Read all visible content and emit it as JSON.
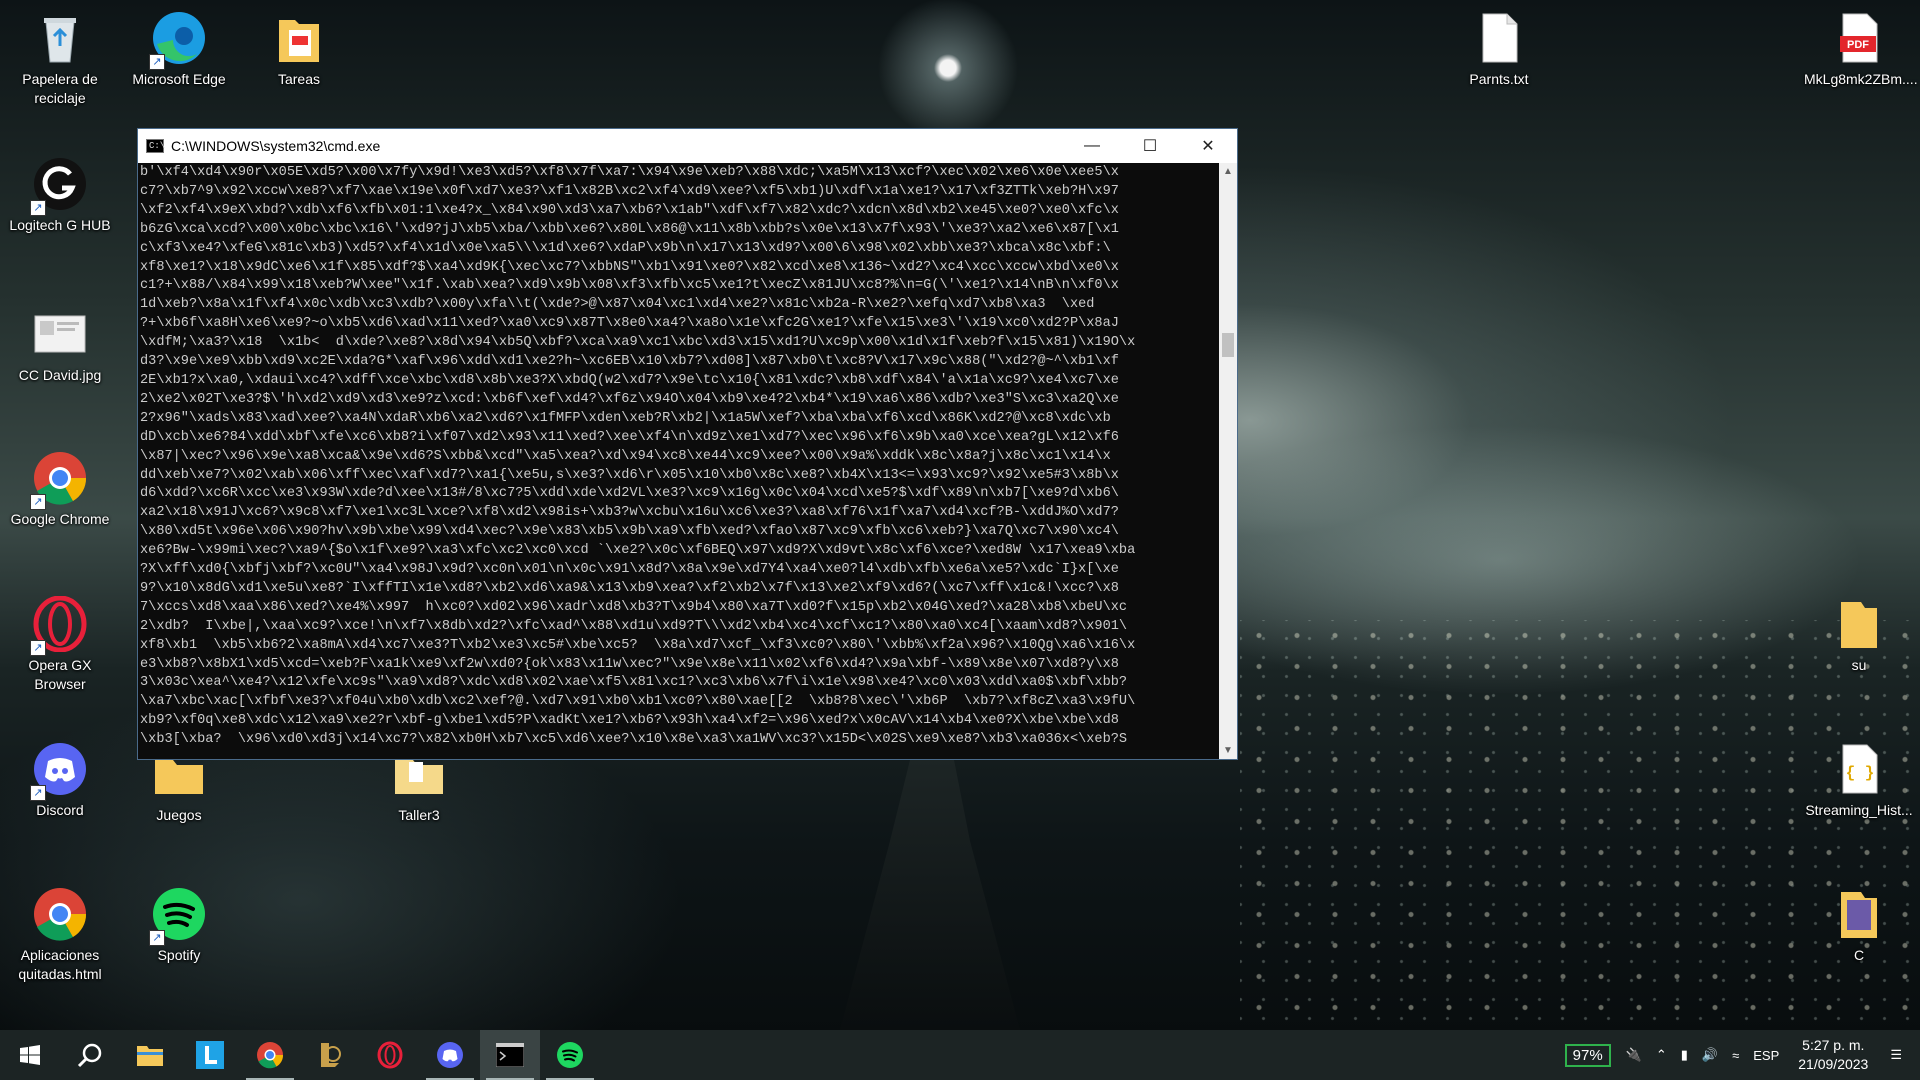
{
  "desktop": {
    "icons": [
      {
        "label": "Papelera de reciclaje",
        "icon": "recycle-bin-icon"
      },
      {
        "label": "Microsoft Edge",
        "icon": "edge-icon"
      },
      {
        "label": "Tareas",
        "icon": "pdf-folder-icon"
      },
      {
        "label": "Logitech G HUB",
        "icon": "logitech-icon"
      },
      {
        "label": "CC David.jpg",
        "icon": "image-file-icon"
      },
      {
        "label": "Google Chrome",
        "icon": "chrome-icon"
      },
      {
        "label": "Opera GX Browser",
        "icon": "opera-icon"
      },
      {
        "label": "Discord",
        "icon": "discord-icon"
      },
      {
        "label": "Juegos",
        "icon": "folder-icon"
      },
      {
        "label": "Taller3",
        "icon": "folder-icon"
      },
      {
        "label": "Aplicaciones quitadas.html",
        "icon": "chrome-icon"
      },
      {
        "label": "Spotify",
        "icon": "spotify-icon"
      },
      {
        "label": "Parnts.txt",
        "icon": "text-file-icon"
      },
      {
        "label": "MkLg8mk2ZBm....",
        "icon": "pdf-icon"
      },
      {
        "label": "su",
        "icon": "folder-icon"
      },
      {
        "label": "Streaming_Hist...",
        "icon": "json-file-icon"
      },
      {
        "label": "C",
        "icon": "folder-icon"
      }
    ]
  },
  "cmd_window": {
    "title": "C:\\WINDOWS\\system32\\cmd.exe",
    "lines": [
      "b'\\xf4\\xd4\\x90r\\x05E\\xd5?\\x00\\x7fy\\x9d!\\xe3\\xd5?\\xf8\\x7f\\xa7:\\x94\\x9e\\xeb?\\x88\\xdc;\\xa5M\\x13\\xcf?\\xec\\x02\\xe6\\x0e\\xee5\\x",
      "c7?\\xb7^9\\x92\\xccw\\xe8?\\xf7\\xae\\x19e\\x0f\\xd7\\xe3?\\xf1\\x82B\\xc2\\xf4\\xd9\\xee?\\xf5\\xb1)U\\xdf\\x1a\\xe1?\\x17\\xf3ZTTk\\xeb?H\\x97",
      "\\xf2\\xf4\\x9eX\\xbd?\\xdb\\xf6\\xfb\\x01:1\\xe4?x_\\x84\\x90\\xd3\\xa7\\xb6?\\x1ab\"\\xdf\\xf7\\x82\\xdc?\\xdcn\\x8d\\xb2\\xe45\\xe0?\\xe0\\xfc\\x",
      "b6zG\\xca\\xcd?\\x00\\x0bc\\xbc\\x16\\'\\xd9?jJ\\xb5\\xba/\\xbb\\xe6?\\x80L\\x86@\\x11\\x8b\\xbb?s\\x0e\\x13\\x7f\\x93\\'\\xe3?\\xa2\\xe6\\x87[\\x1",
      "c\\xf3\\xe4?\\xfeG\\x81c\\xb3)\\xd5?\\xf4\\x1d\\x0e\\xa5\\\\\\x1d\\xe6?\\xdaP\\x9b\\n\\x17\\x13\\xd9?\\x00\\6\\x98\\x02\\xbb\\xe3?\\xbca\\x8c\\xbf:\\",
      "xf8\\xe1?\\x18\\x9dC\\xe6\\x1f\\x85\\xdf?$\\xa4\\xd9K{\\xec\\xc7?\\xbbNS\"\\xb1\\x91\\xe0?\\x82\\xcd\\xe8\\x136~\\xd2?\\xc4\\xcc\\xccw\\xbd\\xe0\\x",
      "c1?+\\x88/\\x84\\x99\\x18\\xeb?W\\xee\"\\x1f.\\xab\\xea?\\xd9\\x9b\\x08\\xf3\\xfb\\xc5\\xe1?t\\xecZ\\x81JU\\xc8?%\\n=G(\\'\\xe1?\\x14\\nB\\n\\xf0\\x",
      "1d\\xeb?\\x8a\\x1f\\xf4\\x0c\\xdb\\xc3\\xdb?\\x00y\\xfa\\\\t(\\xde?>@\\x87\\x04\\xc1\\xd4\\xe2?\\x81c\\xb2a-R\\xe2?\\xefq\\xd7\\xb8\\xa3  \\xed",
      "?+\\xb6f\\xa8H\\xe6\\xe9?~o\\xb5\\xd6\\xad\\x11\\xed?\\xa0\\xc9\\x87T\\x8e0\\xa4?\\xa8o\\x1e\\xfc2G\\xe1?\\xfe\\x15\\xe3\\'\\x19\\xc0\\xd2?P\\x8aJ",
      "\\xdfM;\\xa3?\\x18  \\x1b<  d\\xde?\\xe8?\\x8d\\x94\\xb5Q\\xbf?\\xca\\xa9\\xc1\\xbc\\xd3\\x15\\xd1?U\\xc9p\\x00\\x1d\\x1f\\xeb?f\\x15\\x81)\\x19O\\x",
      "d3?\\x9e\\xe9\\xbb\\xd9\\xc2E\\xda?G*\\xaf\\x96\\xdd\\xd1\\xe2?h~\\xc6EB\\x10\\xb7?\\xd08]\\x87\\xb0\\t\\xc8?V\\x17\\x9c\\x88(\"\\xd2?@~^\\xb1\\xf",
      "2E\\xb1?x\\xa0,\\xdaui\\xc4?\\xdff\\xce\\xbc\\xd8\\x8b\\xe3?X\\xbdQ(w2\\xd7?\\x9e\\tc\\x10{\\x81\\xdc?\\xb8\\xdf\\x84\\'a\\x1a\\xc9?\\xe4\\xc7\\xe",
      "2\\xe2\\x02T\\xe3?$\\'h\\xd2\\xd9\\xd3\\xe9?z\\xcd:\\xb6f\\xef\\xd4?\\xf6z\\x94O\\x04\\xb9\\xe4?2\\xb4*\\x19\\xa6\\x86\\xdb?\\xe3\"S\\xc3\\xa2Q\\xe",
      "2?x96\"\\xads\\x83\\xad\\xee?\\xa4N\\xdaR\\xb6\\xa2\\xd6?\\x1fMFP\\xden\\xeb?R\\xb2|\\x1a5W\\xef?\\xba\\xba\\xf6\\xcd\\x86K\\xd2?@\\xc8\\xdc\\xb",
      "dD\\xcb\\xe6?84\\xdd\\xbf\\xfe\\xc6\\xb8?i\\xf07\\xd2\\x93\\x11\\xed?\\xee\\xf4\\n\\xd9z\\xe1\\xd7?\\xec\\x96\\xf6\\x9b\\xa0\\xce\\xea?gL\\x12\\xf6",
      "\\x87|\\xec?\\x96\\x9e\\xa8\\xca&\\x9e\\xd6?S\\xbb&\\xcd\"\\xa5\\xea?\\xd\\x94\\xc8\\xe44\\xc9\\xee?\\x00\\x9a%\\xddk\\x8c\\x8a?j\\x8c\\xc1\\x14\\x",
      "dd\\xeb\\xe7?\\x02\\xab\\x06\\xff\\xec\\xaf\\xd7?\\xa1{\\xe5u,s\\xe3?\\xd6\\r\\x05\\x10\\xb0\\x8c\\xe8?\\xb4X\\x13<=\\x93\\xc9?\\x92\\xe5#3\\x8b\\x",
      "d6\\xdd?\\xc6R\\xcc\\xe3\\x93W\\xde?d\\xee\\x13#/8\\xc7?5\\xdd\\xde\\xd2VL\\xe3?\\xc9\\x16g\\x0c\\x04\\xcd\\xe5?$\\xdf\\x89\\n\\xb7[\\xe9?d\\xb6\\",
      "xa2\\x18\\x91J\\xc6?\\x9c8\\xf7\\xe1\\xc3L\\xce?\\xf8\\xd2\\x98is+\\xb3?w\\xcbu\\x16u\\xc6\\xe3?\\xa8\\xf76\\x1f\\xa7\\xd4\\xcf?B-\\xddJ%O\\xd7?",
      "\\x80\\xd5t\\x96e\\x06\\x90?hv\\x9b\\xbe\\x99\\xd4\\xec?\\x9e\\x83\\xb5\\x9b\\xa9\\xfb\\xed?\\xfao\\x87\\xc9\\xfb\\xc6\\xeb?}\\xa7Q\\xc7\\x90\\xc4\\",
      "xe6?Bw-\\x99mi\\xec?\\xa9^{$o\\x1f\\xe9?\\xa3\\xfc\\xc2\\xc0\\xcd `\\xe2?\\x0c\\xf6BEQ\\x97\\xd9?X\\xd9vt\\x8c\\xf6\\xce?\\xed8W \\x17\\xea9\\xba",
      "?X\\xff\\xd0{\\xbfj\\xbf?\\xc0U\"\\xa4\\x98J\\x9d?\\xc0n\\x01\\n\\x0c\\x91\\x8d?\\x8a\\x9e\\xd7Y4\\xa4\\xe0?l4\\xdb\\xfb\\xe6a\\xe5?\\xdc`I}x[\\xe",
      "9?\\x10\\x8dG\\xd1\\xe5u\\xe8?`I\\xffTI\\x1e\\xd8?\\xb2\\xd6\\xa9&\\x13\\xb9\\xea?\\xf2\\xb2\\x7f\\x13\\xe2\\xf9\\xd6?(\\xc7\\xff\\x1c&!\\xcc?\\x8",
      "7\\xccs\\xd8\\xaa\\x86\\xed?\\xe4%\\x997  h\\xc0?\\xd02\\x96\\xadr\\xd8\\xb3?T\\x9b4\\x80\\xa7T\\xd0?f\\x15p\\xb2\\x04G\\xed?\\xa28\\xb8\\xbeU\\xc",
      "2\\xdb?  I\\xbe|,\\xaa\\xc9?\\xce!\\n\\xf7\\x8db\\xd2?\\xfc\\xad^\\x88\\xd1u\\xd9?T\\\\\\xd2\\xb4\\xc4\\xcf\\xc1?\\x80\\xa0\\xc4[\\xaam\\xd8?\\x901\\",
      "xf8\\xb1  \\xb5\\xb6?2\\xa8mA\\xd4\\xc7\\xe3?T\\xb2\\xe3\\xc5#\\xbe\\xc5?  \\x8a\\xd7\\xcf_\\xf3\\xc0?\\x80\\'\\xbb%\\xf2a\\x96?\\x10Qg\\xa6\\x16\\x",
      "e3\\xb8?\\x8bX1\\xd5\\xcd=\\xeb?F\\xa1k\\xe9\\xf2w\\xd0?{ok\\x83\\x11w\\xec?\"\\x9e\\x8e\\x11\\x02\\xf6\\xd4?\\x9a\\xbf-\\x89\\x8e\\x07\\xd8?y\\x8",
      "3\\x03c\\xea^\\xe4?\\x12\\xfe\\xc9s\"\\xa9\\xd8?\\xdc\\xd8\\x02\\xae\\xf5\\x81\\xc1?\\xc3\\xb6\\x7f\\i\\x1e\\x98\\xe4?\\xc0\\x03\\xdd\\xa0$\\xbf\\xbb?",
      "\\xa7\\xbc\\xac[\\xfbf\\xe3?\\xf04u\\xb0\\xdb\\xc2\\xef?@.\\xd7\\x91\\xb0\\xb1\\xc0?\\x80\\xae[[2  \\xb8?8\\xec\\'\\xb6P  \\xb7?\\xf8cZ\\xa3\\x9fU\\",
      "xb9?\\xf0q\\xe8\\xdc\\x12\\xa9\\xe2?r\\xbf-g\\xbe1\\xd5?P\\xadKt\\xe1?\\xb6?\\x93h\\xa4\\xf2=\\x96\\xed?x\\x0cAV\\x14\\xb4\\xe0?X\\xbe\\xbe\\xd8",
      "\\xb3[\\xba?  \\x96\\xd0\\xd3j\\x14\\xc7?\\x82\\xb0H\\xb7\\xc5\\xd6\\xee?\\x10\\x8e\\xa3\\xa1WV\\xc3?\\x15D<\\x02S\\xe9\\xe8?\\xb3\\xa036x<\\xeb?S"
    ]
  },
  "taskbar": {
    "apps": [
      "start-icon",
      "search-icon",
      "file-explorer-icon",
      "l-app-icon",
      "chrome-icon",
      "league-icon",
      "opera-icon",
      "discord-icon",
      "terminal-icon",
      "spotify-icon"
    ],
    "battery_percent": "97%",
    "language": "ESP",
    "time": "5:27 p. m.",
    "date": "21/09/2023"
  }
}
